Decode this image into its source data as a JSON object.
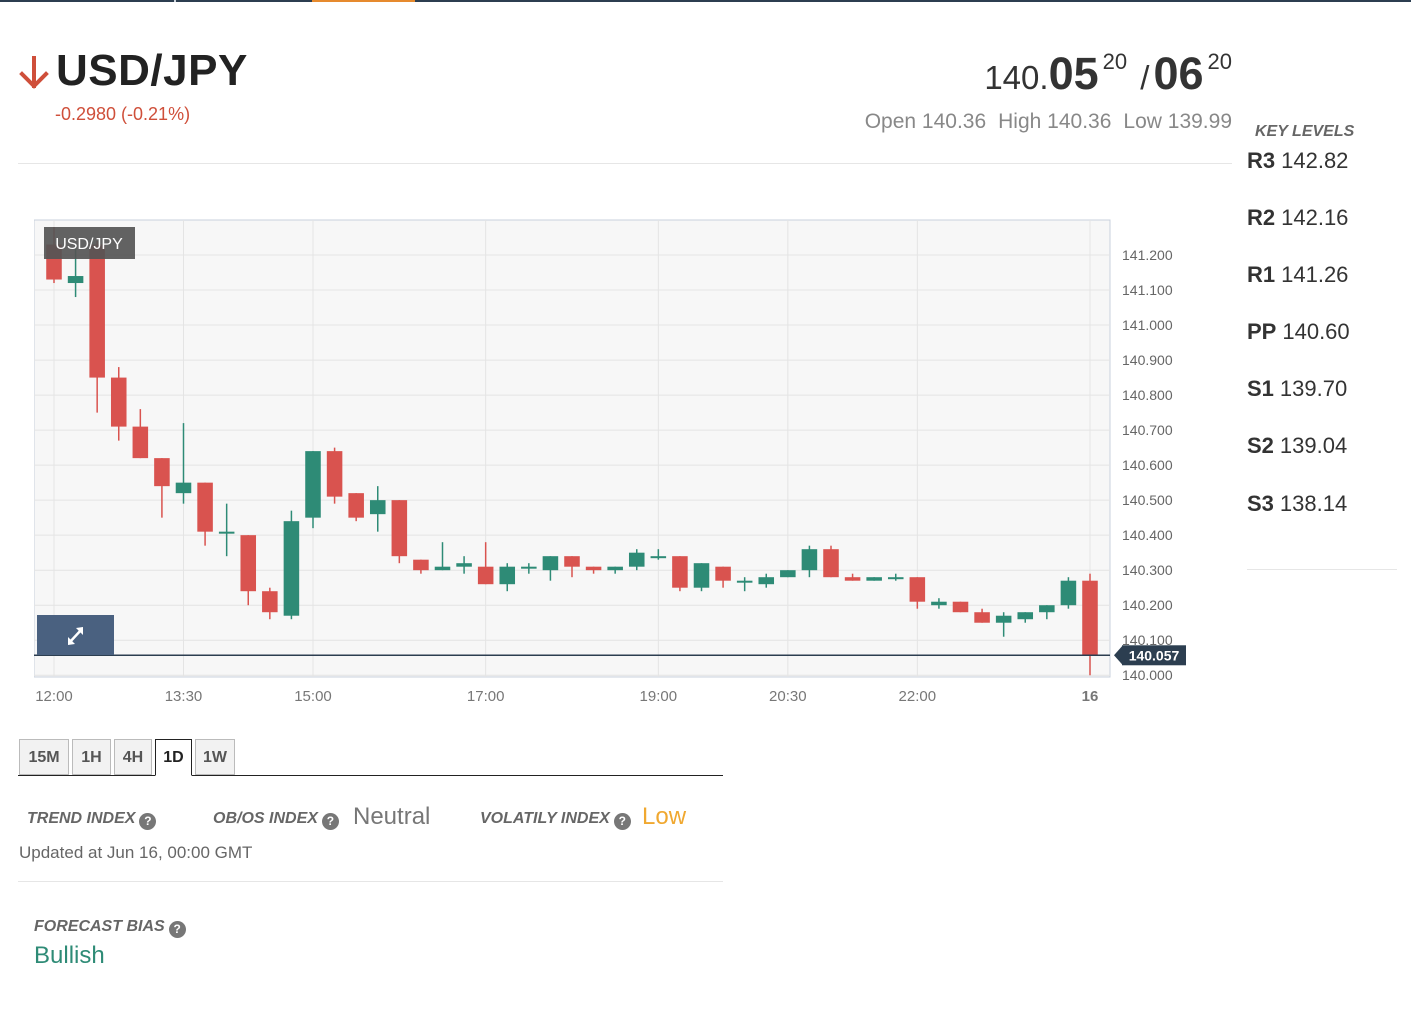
{
  "header": {
    "symbol": "USD/JPY",
    "change": "-0.2980 (-0.21%)",
    "quote": {
      "prefix": "140.",
      "bid_big": "05",
      "bid_sup": "20",
      "separator": "/",
      "ask_big": "06",
      "ask_sup": "20"
    },
    "ohl": {
      "open": "Open 140.36",
      "high": "High 140.36",
      "low": "Low 139.99"
    }
  },
  "key_levels": {
    "title": "KEY LEVELS",
    "items": [
      {
        "label": "R3",
        "value": "142.82"
      },
      {
        "label": "R2",
        "value": "142.16"
      },
      {
        "label": "R1",
        "value": "141.26"
      },
      {
        "label": "PP",
        "value": "140.60"
      },
      {
        "label": "S1",
        "value": "139.70"
      },
      {
        "label": "S2",
        "value": "139.04"
      },
      {
        "label": "S3",
        "value": "138.14"
      }
    ]
  },
  "timeframes": [
    "15M",
    "1H",
    "4H",
    "1D",
    "1W"
  ],
  "active_timeframe": "1D",
  "indices": {
    "trend_label": "TREND INDEX",
    "obos_label": "OB/OS INDEX",
    "obos_value": "Neutral",
    "volatility_label": "VOLATILY INDEX",
    "volatility_value": "Low",
    "updated": "Updated at Jun 16, 00:00 GMT"
  },
  "forecast": {
    "label": "FORECAST BIAS",
    "value": "Bullish"
  },
  "help_glyph": "?",
  "colors": {
    "up": "#2e8b76",
    "down": "#d9534f",
    "accent": "#e68a2e",
    "change": "#cf4f3a",
    "neutral_value": "#777777",
    "volatility_value": "#f0a830",
    "price_tag": "#2c3e50",
    "expand_button": "#4a6180"
  },
  "icons": {
    "direction": "arrow-down-icon",
    "expand": "expand-icon",
    "help": "question-circle-icon"
  },
  "chart_data": {
    "type": "candlestick",
    "symbol_label": "USD/JPY",
    "y_ticks": [
      141.2,
      141.1,
      141.0,
      140.9,
      140.8,
      140.7,
      140.6,
      140.5,
      140.4,
      140.3,
      140.2,
      140.1,
      140.0
    ],
    "ylim": [
      139.995,
      141.3
    ],
    "x_tick_labels": [
      {
        "label": "12:00",
        "index": 0
      },
      {
        "label": "13:30",
        "index": 6
      },
      {
        "label": "15:00",
        "index": 12
      },
      {
        "label": "17:00",
        "index": 20
      },
      {
        "label": "19:00",
        "index": 28
      },
      {
        "label": "20:30",
        "index": 34
      },
      {
        "label": "22:00",
        "index": 40
      },
      {
        "label": "16",
        "index": 48
      }
    ],
    "candles": [
      {
        "o": 141.23,
        "h": 141.28,
        "l": 141.12,
        "c": 141.13
      },
      {
        "o": 141.12,
        "h": 141.23,
        "l": 141.08,
        "c": 141.14
      },
      {
        "o": 141.23,
        "h": 141.24,
        "l": 140.75,
        "c": 140.85
      },
      {
        "o": 140.85,
        "h": 140.88,
        "l": 140.67,
        "c": 140.71
      },
      {
        "o": 140.71,
        "h": 140.76,
        "l": 140.62,
        "c": 140.62
      },
      {
        "o": 140.62,
        "h": 140.62,
        "l": 140.45,
        "c": 140.54
      },
      {
        "o": 140.52,
        "h": 140.72,
        "l": 140.49,
        "c": 140.55
      },
      {
        "o": 140.55,
        "h": 140.55,
        "l": 140.37,
        "c": 140.41
      },
      {
        "o": 140.41,
        "h": 140.49,
        "l": 140.34,
        "c": 140.41
      },
      {
        "o": 140.4,
        "h": 140.4,
        "l": 140.2,
        "c": 140.24
      },
      {
        "o": 140.24,
        "h": 140.25,
        "l": 140.16,
        "c": 140.18
      },
      {
        "o": 140.17,
        "h": 140.47,
        "l": 140.16,
        "c": 140.44
      },
      {
        "o": 140.45,
        "h": 140.64,
        "l": 140.42,
        "c": 140.64
      },
      {
        "o": 140.64,
        "h": 140.65,
        "l": 140.49,
        "c": 140.51
      },
      {
        "o": 140.52,
        "h": 140.52,
        "l": 140.44,
        "c": 140.45
      },
      {
        "o": 140.46,
        "h": 140.54,
        "l": 140.41,
        "c": 140.5
      },
      {
        "o": 140.5,
        "h": 140.5,
        "l": 140.32,
        "c": 140.34
      },
      {
        "o": 140.33,
        "h": 140.33,
        "l": 140.29,
        "c": 140.3
      },
      {
        "o": 140.3,
        "h": 140.38,
        "l": 140.3,
        "c": 140.31
      },
      {
        "o": 140.31,
        "h": 140.34,
        "l": 140.29,
        "c": 140.32
      },
      {
        "o": 140.31,
        "h": 140.38,
        "l": 140.26,
        "c": 140.26
      },
      {
        "o": 140.26,
        "h": 140.32,
        "l": 140.24,
        "c": 140.31
      },
      {
        "o": 140.31,
        "h": 140.32,
        "l": 140.29,
        "c": 140.31
      },
      {
        "o": 140.3,
        "h": 140.34,
        "l": 140.27,
        "c": 140.34
      },
      {
        "o": 140.34,
        "h": 140.34,
        "l": 140.28,
        "c": 140.31
      },
      {
        "o": 140.31,
        "h": 140.31,
        "l": 140.29,
        "c": 140.3
      },
      {
        "o": 140.3,
        "h": 140.31,
        "l": 140.29,
        "c": 140.31
      },
      {
        "o": 140.31,
        "h": 140.36,
        "l": 140.3,
        "c": 140.35
      },
      {
        "o": 140.34,
        "h": 140.36,
        "l": 140.33,
        "c": 140.34
      },
      {
        "o": 140.34,
        "h": 140.34,
        "l": 140.24,
        "c": 140.25
      },
      {
        "o": 140.25,
        "h": 140.32,
        "l": 140.24,
        "c": 140.32
      },
      {
        "o": 140.31,
        "h": 140.31,
        "l": 140.25,
        "c": 140.27
      },
      {
        "o": 140.27,
        "h": 140.28,
        "l": 140.24,
        "c": 140.27
      },
      {
        "o": 140.26,
        "h": 140.29,
        "l": 140.25,
        "c": 140.28
      },
      {
        "o": 140.28,
        "h": 140.3,
        "l": 140.28,
        "c": 140.3
      },
      {
        "o": 140.3,
        "h": 140.37,
        "l": 140.28,
        "c": 140.36
      },
      {
        "o": 140.36,
        "h": 140.37,
        "l": 140.28,
        "c": 140.28
      },
      {
        "o": 140.28,
        "h": 140.29,
        "l": 140.27,
        "c": 140.27
      },
      {
        "o": 140.27,
        "h": 140.28,
        "l": 140.27,
        "c": 140.28
      },
      {
        "o": 140.28,
        "h": 140.29,
        "l": 140.27,
        "c": 140.28
      },
      {
        "o": 140.28,
        "h": 140.28,
        "l": 140.19,
        "c": 140.21
      },
      {
        "o": 140.2,
        "h": 140.22,
        "l": 140.19,
        "c": 140.21
      },
      {
        "o": 140.21,
        "h": 140.21,
        "l": 140.18,
        "c": 140.18
      },
      {
        "o": 140.18,
        "h": 140.19,
        "l": 140.15,
        "c": 140.15
      },
      {
        "o": 140.15,
        "h": 140.18,
        "l": 140.11,
        "c": 140.17
      },
      {
        "o": 140.16,
        "h": 140.18,
        "l": 140.15,
        "c": 140.18
      },
      {
        "o": 140.18,
        "h": 140.2,
        "l": 140.16,
        "c": 140.2
      },
      {
        "o": 140.2,
        "h": 140.28,
        "l": 140.19,
        "c": 140.27
      },
      {
        "o": 140.27,
        "h": 140.29,
        "l": 140.0,
        "c": 140.057
      }
    ],
    "last_price": 140.057,
    "last_price_label": "140.057",
    "grid": true
  }
}
